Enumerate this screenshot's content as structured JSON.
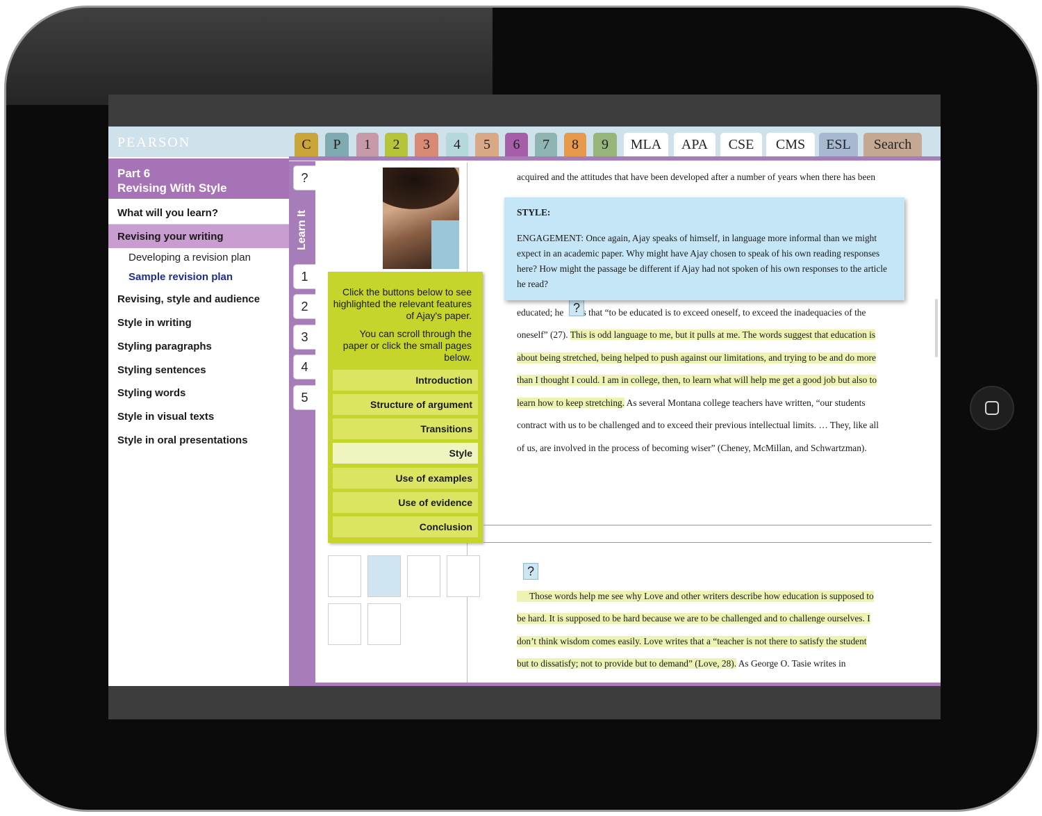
{
  "brand": "PEARSON",
  "tabs": [
    {
      "label": "C",
      "color": "#c9a53a"
    },
    {
      "label": "P",
      "color": "#7faab2"
    },
    {
      "label": "1",
      "color": "#c79aaa"
    },
    {
      "label": "2",
      "color": "#b6c43a"
    },
    {
      "label": "3",
      "color": "#d98a74"
    },
    {
      "label": "4",
      "color": "#b5d8dc"
    },
    {
      "label": "5",
      "color": "#d9a986"
    },
    {
      "label": "6",
      "color": "#a65ea8"
    },
    {
      "label": "7",
      "color": "#8fb5b2"
    },
    {
      "label": "8",
      "color": "#e79a4c"
    },
    {
      "label": "9",
      "color": "#97b47a"
    },
    {
      "label": "MLA",
      "color": "#ffffff"
    },
    {
      "label": "APA",
      "color": "#ffffff"
    },
    {
      "label": "CSE",
      "color": "#ffffff"
    },
    {
      "label": "CMS",
      "color": "#ffffff"
    },
    {
      "label": "ESL",
      "color": "#a8b8d0"
    },
    {
      "label": "Search",
      "color": "#c5a892"
    }
  ],
  "sidebar": {
    "part": "Part 6",
    "part_title": "Revising With Style",
    "items": [
      {
        "label": "What will you learn?"
      },
      {
        "label": "Revising your writing"
      },
      {
        "label": "Developing a revision plan"
      },
      {
        "label": "Sample revision plan"
      },
      {
        "label": "Revising, style and audience"
      },
      {
        "label": "Style in writing"
      },
      {
        "label": "Styling paragraphs"
      },
      {
        "label": "Styling sentences"
      },
      {
        "label": "Styling words"
      },
      {
        "label": "Style in visual texts"
      },
      {
        "label": "Style in oral presentations"
      }
    ]
  },
  "learn": {
    "help": "?",
    "label": "Learn It",
    "tabs": [
      "1",
      "2",
      "3",
      "4",
      "5"
    ]
  },
  "panel": {
    "intro": "Click the buttons below to see highlighted the relevant features of Ajay's paper.",
    "scroll_hint": "You can scroll through the paper or click the small pages below.",
    "buttons": [
      "Introduction",
      "Structure of argument",
      "Transitions",
      "Style",
      "Use of examples",
      "Use of evidence",
      "Conclusion"
    ],
    "selected": "Style"
  },
  "popup": {
    "title": "STYLE:",
    "body": "ENGAGEMENT: Once again, Ajay speaks of himself, in language more informal than we might expect in an academic paper. Why might have Ajay chosen to speak of his own reading responses here? How might the passage be different if Ajay had not spoken of his own responses to the article he read?"
  },
  "doc": {
    "q": "?",
    "line1": "acquired and the attitudes that have been developed after a number of years when there has been",
    "line2a": "educated; he ",
    "line2b": "es that “to be educated is to exceed oneself, to exceed the inadequacies of the",
    "line3a": "oneself” (27). ",
    "line3b": "This is odd language to me, but it pulls at me. The words suggest that education is",
    "line4": "about being stretched, being helped to push against our limitations, and trying to be and do more",
    "line5": "than I thought I could. I am in college, then, to learn what will help me get a good job but also to",
    "line6a": "learn how to keep stretching.",
    "line6b": " As several Montana college teachers have written, “our students",
    "line7": "contract with us to be challenged and to exceed their previous intellectual limits. … They, like all",
    "line8": "of us, are involved in the process of becoming wiser” (Cheney, McMillan, and Schwartzman).",
    "p2line1": "Those words help me see why Love and other writers describe how education is supposed to",
    "p2line2": "be hard. It is supposed to be hard because we are to be challenged and to challenge ourselves. I",
    "p2line3": "don’t think wisdom comes easily. Love writes that a “teacher is not there to satisfy the student",
    "p2line4a": "but to dissatisfy; not to provide but to demand” (Love, 28).",
    "p2line4b": " As George O. Tasie writes in"
  }
}
